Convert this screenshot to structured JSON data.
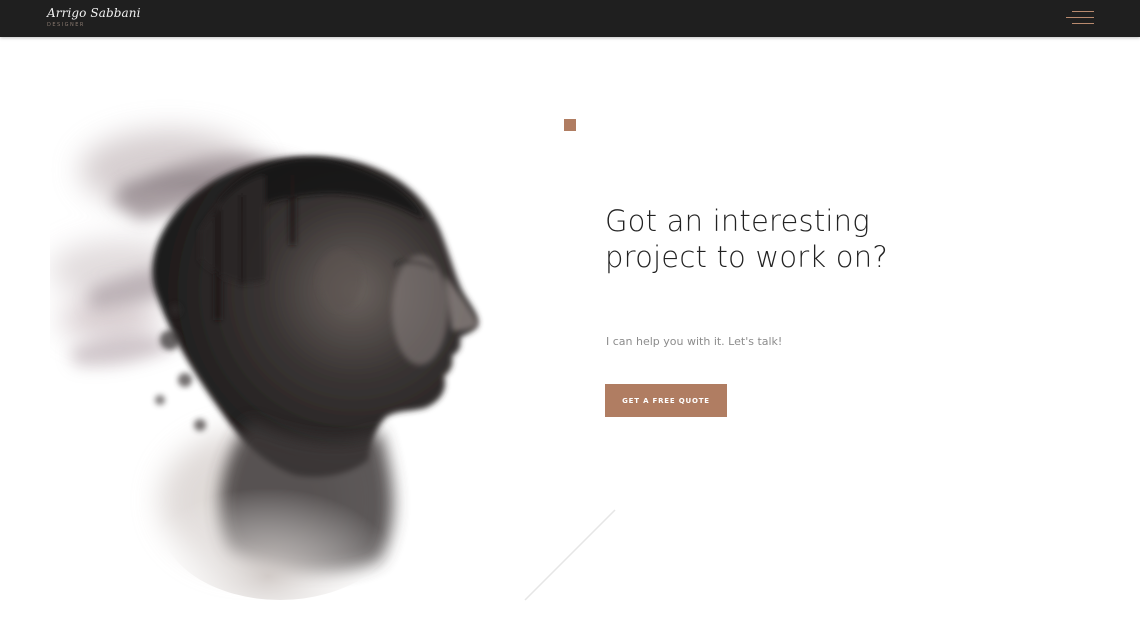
{
  "header": {
    "brand_name": "Arrigo Sabbani",
    "brand_subtitle": "DESIGNER",
    "menu_icon": "hamburger-menu-icon"
  },
  "hero": {
    "headline": "Got an interesting project to work on?",
    "subtext": "I can help you with it. Let's talk!",
    "cta_label": "GET A FREE QUOTE",
    "image": "double-exposure-portrait"
  },
  "colors": {
    "navbar_bg": "#1f1f1f",
    "accent": "#b07d62",
    "heading": "#222222",
    "body_text": "#8c8c8c"
  }
}
